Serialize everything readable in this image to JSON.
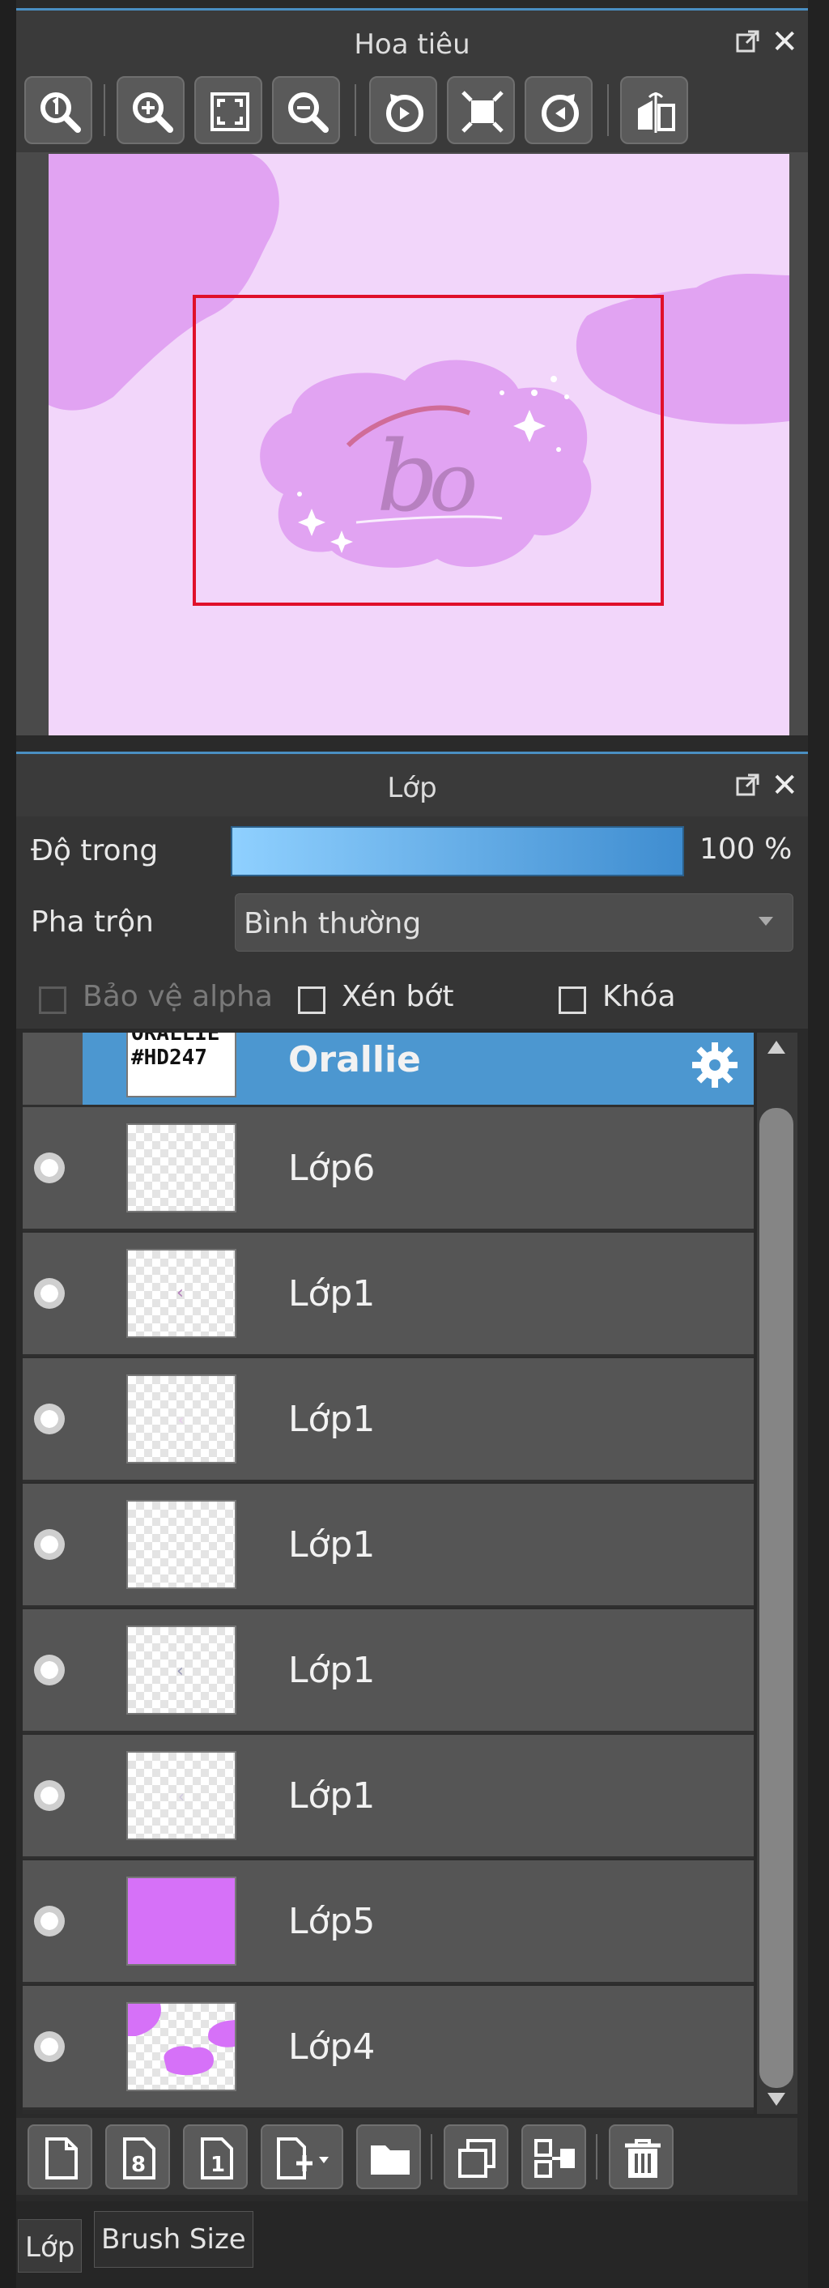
{
  "navigator": {
    "title": "Hoa tiêu",
    "toolbar": [
      "zoom-100-icon",
      "zoom-in-icon",
      "fit-screen-icon",
      "zoom-out-icon",
      "rotate-left-icon",
      "fit-canvas-icon",
      "rotate-right-icon",
      "flip-horizontal-icon"
    ]
  },
  "layer_panel": {
    "title": "Lớp",
    "opacity_label": "Độ trong",
    "opacity_value": "100 %",
    "opacity_fraction": 1.0,
    "blend_label": "Pha trộn",
    "blend_value": "Bình thường",
    "protect_alpha_label": "Bảo vệ alpha",
    "clipping_label": "Xén bớt",
    "lock_label": "Khóa",
    "layers": [
      {
        "name": "Orallie",
        "thumb_text_1": "ORALLIE",
        "thumb_text_2": "#HD247",
        "active": true
      },
      {
        "name": "Lớp6"
      },
      {
        "name": "Lớp1"
      },
      {
        "name": "Lớp1"
      },
      {
        "name": "Lớp1"
      },
      {
        "name": "Lớp1"
      },
      {
        "name": "Lớp1"
      },
      {
        "name": "Lớp5"
      },
      {
        "name": "Lớp4"
      }
    ]
  },
  "tabs": {
    "layer": "Lớp",
    "brush_size": "Brush Size"
  },
  "colors": {
    "accent": "#4c97d0",
    "canvas_bg": "#f2d6fa",
    "blob": "#e1a3f2",
    "view_rect": "#e0102a",
    "layer5_fill": "#d671f8"
  }
}
